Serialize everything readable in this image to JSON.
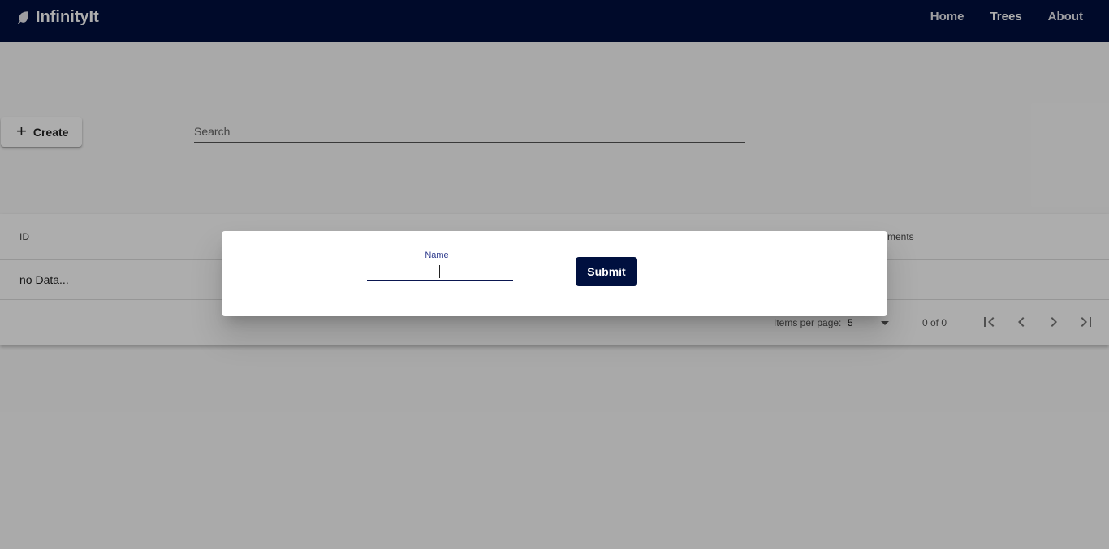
{
  "app": {
    "brand": "InfinityIt",
    "brand_icon": "leaf-icon",
    "nav": [
      {
        "label": "Home"
      },
      {
        "label": "Trees"
      },
      {
        "label": "About"
      }
    ],
    "active_nav": "Trees",
    "colors": {
      "toolbar": "#00103f",
      "primary": "#00103f"
    }
  },
  "actions": {
    "create_label": "Create",
    "create_icon": "plus-icon"
  },
  "search": {
    "placeholder": "Search",
    "value": ""
  },
  "table": {
    "columns": [
      {
        "label": "ID"
      },
      {
        "label": "ments"
      }
    ],
    "empty_text": "no Data...",
    "paginator": {
      "items_per_page_label": "Items per page:",
      "items_per_page_value": "5",
      "range_label": "0 of 0",
      "buttons": [
        "first-page-icon",
        "previous-page-icon",
        "next-page-icon",
        "last-page-icon"
      ]
    }
  },
  "dialog": {
    "name_label": "Name",
    "name_value": "",
    "submit_label": "Submit"
  }
}
